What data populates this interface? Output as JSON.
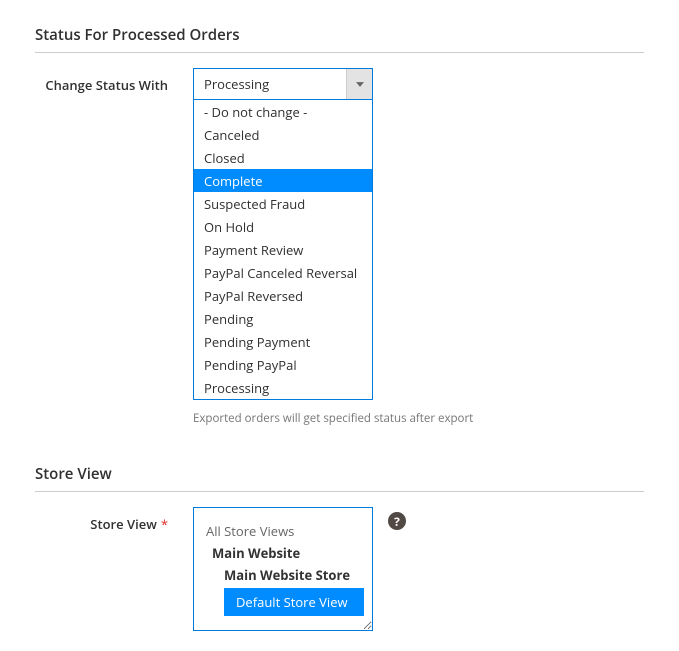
{
  "section1": {
    "title": "Status For Processed Orders",
    "label": "Change Status With",
    "selected": "Processing",
    "options": [
      "- Do not change -",
      "Canceled",
      "Closed",
      "Complete",
      "Suspected Fraud",
      "On Hold",
      "Payment Review",
      "PayPal Canceled Reversal",
      "PayPal Reversed",
      "Pending",
      "Pending Payment",
      "Pending PayPal",
      "Processing"
    ],
    "highlighted_index": 3,
    "help": "Exported orders will get specified status after export"
  },
  "section2": {
    "title": "Store View",
    "label": "Store View",
    "tree": {
      "all": "All Store Views",
      "website": "Main Website",
      "store": "Main Website Store",
      "view": "Default Store View"
    }
  }
}
